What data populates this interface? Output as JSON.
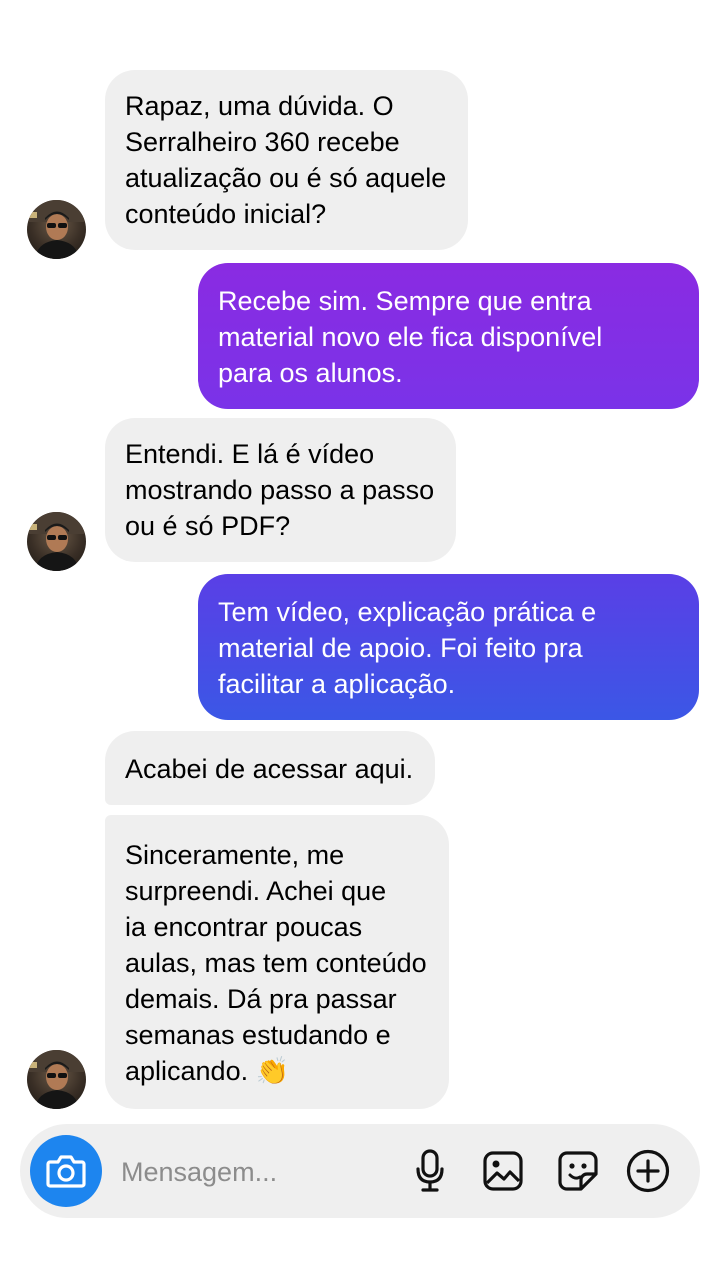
{
  "colors": {
    "incoming_bubble": "#efefef",
    "outgoing_gradient_top": "#8a2be2",
    "outgoing_gradient_bottom": "#3b57e6",
    "camera_button": "#1d85ef"
  },
  "messages": [
    {
      "direction": "incoming",
      "text": "Rapaz, uma dúvida. O\nSerralheiro 360 recebe\natualização ou é só aquele\nconteúdo inicial?"
    },
    {
      "direction": "outgoing",
      "text": "Recebe sim. Sempre que entra\nmaterial novo ele fica disponível\npara os alunos."
    },
    {
      "direction": "incoming",
      "text": "Entendi. E lá é vídeo\nmostrando passo a passo\nou é só PDF?"
    },
    {
      "direction": "outgoing",
      "text": "Tem vídeo, explicação prática e\nmaterial de apoio. Foi feito pra\nfacilitar a aplicação."
    },
    {
      "direction": "incoming",
      "text": "Acabei de acessar aqui."
    },
    {
      "direction": "incoming",
      "text": "Sinceramente, me\nsurpreendi. Achei que\nia encontrar poucas\naulas, mas tem conteúdo\ndemais. Dá pra passar\nsemanas estudando e\naplicando. 👏"
    }
  ],
  "composer": {
    "placeholder": "Mensagem...",
    "icons": [
      "camera-icon",
      "microphone-icon",
      "gallery-icon",
      "sticker-icon",
      "add-icon"
    ]
  }
}
